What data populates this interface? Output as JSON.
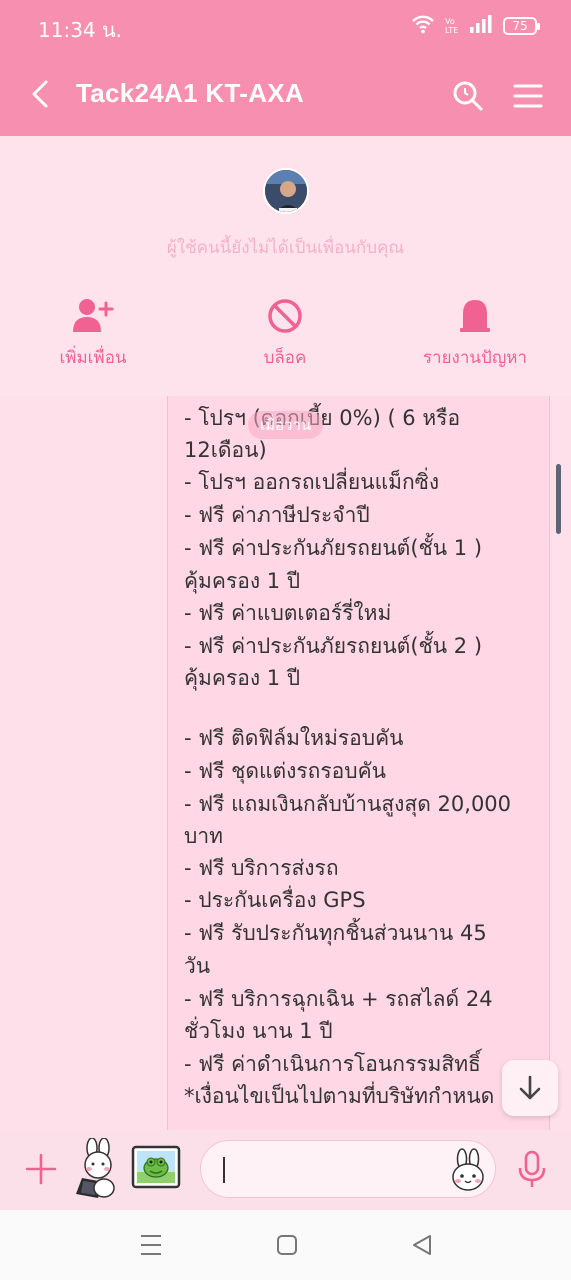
{
  "status_bar": {
    "time": "11:34 น.",
    "volte": "Vo LTE",
    "battery": "75",
    "icons": [
      "wifi-icon",
      "volte-icon",
      "signal-icon",
      "battery-icon"
    ]
  },
  "header": {
    "title": "Tack24A1 KT-AXA",
    "icons": [
      "back-icon",
      "search-icon",
      "menu-icon"
    ]
  },
  "profile": {
    "notice": "ผู้ใช้คนนี้ยังไม่ได้เป็นเพื่อนกับคุณ",
    "actions": [
      {
        "label": "เพิ่มเพื่อน",
        "icon": "add-friend-icon"
      },
      {
        "label": "บล็อค",
        "icon": "block-icon"
      },
      {
        "label": "รายงานปัญหา",
        "icon": "report-icon"
      }
    ]
  },
  "chat": {
    "date_label": "เมื่อวาน",
    "message_lines": [
      " - โปรฯ (ดอกเบี้ย 0%) ( 6 หรือ",
      "12เดือน)",
      " - โปรฯ ออกรถเปลี่ยนแม็กซิ่ง",
      " - ฟรี ค่าภาษีประจำปี",
      " - ฟรี ค่าประกันภัยรถยนต์(ชั้น 1 )",
      "คุ้มครอง 1 ปี",
      " - ฟรี ค่าแบตเตอร์รี่ใหม่",
      " - ฟรี ค่าประกันภัยรถยนต์(ชั้น 2 )",
      "คุ้มครอง 1 ปี",
      " - ฟรี ติดฟิล์มใหม่รอบคัน",
      " - ฟรี ชุดแต่งรถรอบคัน",
      " - ฟรี แถมเงินกลับบ้านสูงสุด 20,000",
      "บาท",
      " - ฟรี บริการส่งรถ",
      " - ประกันเครื่อง GPS",
      " - ฟรี รับประกันทุกชิ้นส่วนนาน 45",
      "วัน",
      " - ฟรี บริการฉุกเฉิน + รถสไลด์ 24",
      "ชั่วโมง นาน 1 ปี",
      " - ฟรี ค่าดำเนินการโอนกรรมสิทธิ์",
      "*เงื่อนไขเป็นไปตามที่บริษัทกำหนด"
    ]
  },
  "input_bar": {
    "icons": [
      "plus-icon",
      "cony-sticker-icon",
      "frog-sticker-icon",
      "emoji-icon",
      "mic-icon"
    ]
  },
  "nav": {
    "icons": [
      "recent-apps-icon",
      "home-icon",
      "back-nav-icon"
    ]
  },
  "colors": {
    "header": "#f78fb1",
    "accent": "#f06292",
    "chat_bg": "#fde0ea",
    "bubble": "#ffd7e5"
  }
}
